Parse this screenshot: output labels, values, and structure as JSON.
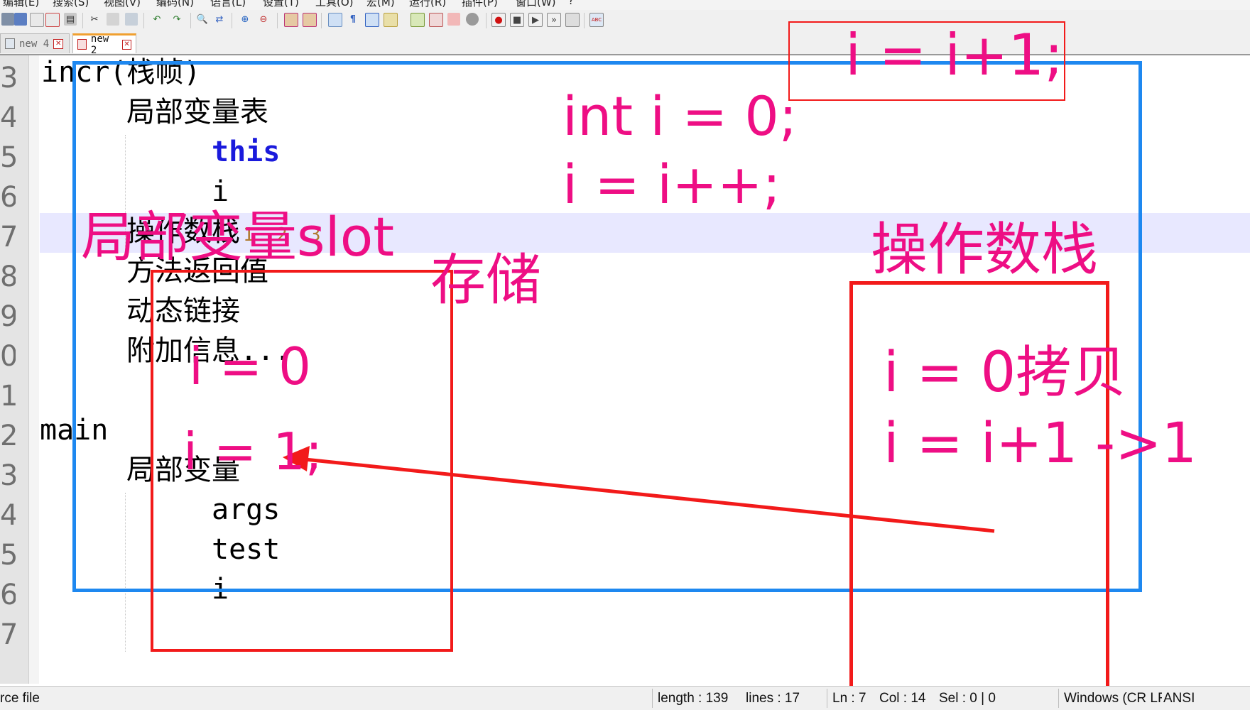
{
  "menu": [
    "编辑(E)",
    "搜索(S)",
    "视图(V)",
    "编码(N)",
    "语言(L)",
    "设置(T)",
    "工具(O)",
    "宏(M)",
    "运行(R)",
    "插件(P)",
    "窗口(W)",
    "?"
  ],
  "toolbar_icons": [
    "new-file-icon",
    "open-file-icon",
    "save-icon",
    "save-all-icon",
    "close-icon",
    "close-all-icon",
    "print-icon",
    "cut-icon",
    "copy-icon",
    "paste-icon",
    "undo-icon",
    "redo-icon",
    "find-icon",
    "replace-icon",
    "zoom-in-icon",
    "zoom-out-icon",
    "sync-vertical-icon",
    "sync-horizontal-icon",
    "word-wrap-icon",
    "show-all-chars-icon",
    "indent-guide-icon",
    "user-language-icon",
    "doc-map-icon",
    "function-list-icon",
    "folder-workspace-icon",
    "monitoring-icon",
    "record-macro-icon",
    "stop-macro-icon",
    "play-macro-icon",
    "run-macro-multiple-icon",
    "save-macro-icon",
    "spellcheck-icon"
  ],
  "tabs": [
    {
      "label": "new 4",
      "active": false
    },
    {
      "label": "new 2",
      "active": true
    }
  ],
  "editor": {
    "line_numbers": [
      "3",
      "4",
      "5",
      "6",
      "7",
      "8",
      "9",
      "0",
      "1",
      "2",
      "3",
      "4",
      "5",
      "6",
      "7"
    ],
    "lines": [
      "incr",
      "局部变量表",
      "this",
      "i",
      "操作数栈",
      "方法返回值",
      "动态链接",
      "附加信息...",
      "",
      "main",
      "局部变量",
      "args",
      "test",
      "i",
      ""
    ],
    "frame_label": "(栈帧)",
    "operand_stack_marks": "1  2  3"
  },
  "annotations": {
    "top_right_code": "i = i+1;",
    "code_line1": "int i = 0;",
    "code_line2": "i = i++;",
    "local_slot_label": "局部变量slot",
    "storage_label": "存储",
    "operand_stack_label": "操作数栈",
    "slot_value_1": "i = 0",
    "slot_value_2": "i = 1;",
    "stack_step_1": "i = 0拷贝",
    "stack_step_2": "i = i+1 ->1",
    "colors": {
      "pink": "#ee0e84",
      "red_box": "#f21a1a",
      "blue_box": "#1e88f0"
    }
  },
  "status": {
    "file_type": "rce file",
    "length": "length : 139",
    "lines": "lines : 17",
    "ln": "Ln : 7",
    "col": "Col : 14",
    "sel": "Sel : 0 | 0",
    "eol": "Windows (CR LF)",
    "encoding": "ANSI"
  }
}
